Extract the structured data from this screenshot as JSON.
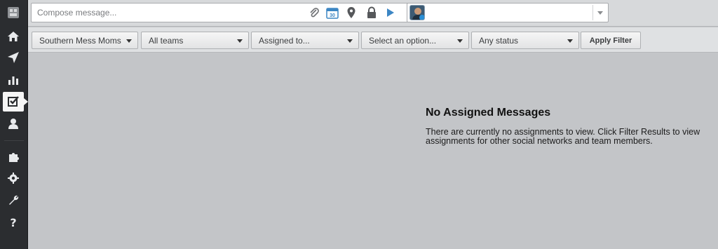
{
  "compose": {
    "placeholder": "Compose message...",
    "calendar_day": "30",
    "icons": [
      "paperclip-icon",
      "calendar-icon",
      "location-pin-icon",
      "lock-icon",
      "send-icon"
    ]
  },
  "profile_picker": {
    "selected": "",
    "icons": [
      "avatar",
      "chevron-down-icon"
    ]
  },
  "sidebar": {
    "items": [
      {
        "name": "logo-icon"
      },
      {
        "name": "home-icon"
      },
      {
        "name": "send-icon"
      },
      {
        "name": "analytics-icon"
      },
      {
        "name": "assignments-icon",
        "active": true
      },
      {
        "name": "contacts-icon"
      },
      {
        "name": "apps-icon"
      },
      {
        "name": "settings-icon"
      },
      {
        "name": "tools-icon"
      },
      {
        "name": "help-icon"
      }
    ]
  },
  "filters": {
    "network": "Southern Mess Moms",
    "teams": "All teams",
    "assigned": "Assigned to...",
    "option": "Select an option...",
    "status": "Any status",
    "apply": "Apply Filter"
  },
  "empty_state": {
    "title": "No Assigned Messages",
    "message": "There are currently no assignments to view. Click Filter Results to view assignments for other social networks and team members."
  }
}
